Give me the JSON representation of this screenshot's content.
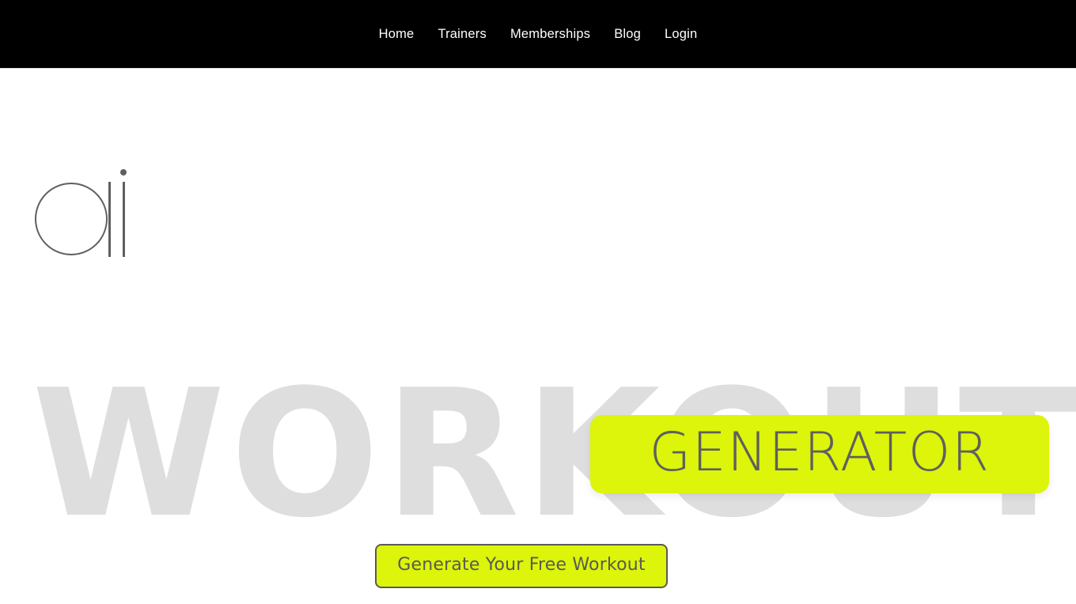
{
  "nav": {
    "items": [
      {
        "label": "Home",
        "name": "nav-item-home"
      },
      {
        "label": "Trainers",
        "name": "nav-item-trainers"
      },
      {
        "label": "Memberships",
        "name": "nav-item-memberships"
      },
      {
        "label": "Blog",
        "name": "nav-item-blog"
      },
      {
        "label": "Login",
        "name": "nav-item-login"
      }
    ]
  },
  "hero": {
    "logo_text": "ai",
    "headline_word": "WORKOUT",
    "highlight_word": "GENERATOR",
    "cta_label": "Generate Your Free Workout"
  },
  "colors": {
    "nav_background": "#000000",
    "nav_text": "#ffffff",
    "page_background": "#ffffff",
    "accent_lime": "#dcf50a",
    "headline_gray": "#dedede",
    "logo_gray": "#5f5f5f",
    "cta_text": "#5a5a52",
    "cta_border": "#5a5a52"
  }
}
